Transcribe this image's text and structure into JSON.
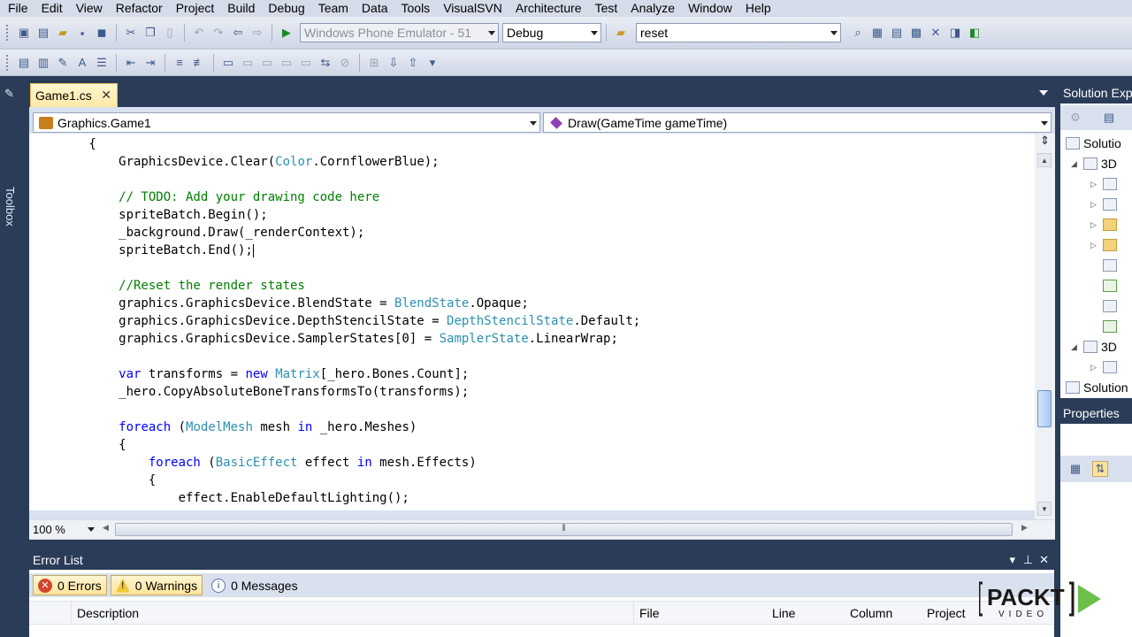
{
  "menu": [
    "File",
    "Edit",
    "View",
    "Refactor",
    "Project",
    "Build",
    "Debug",
    "Team",
    "Data",
    "Tools",
    "VisualSVN",
    "Architecture",
    "Test",
    "Analyze",
    "Window",
    "Help"
  ],
  "toolbar": {
    "target_device": "Windows Phone Emulator - 51",
    "configuration": "Debug",
    "find_value": "reset"
  },
  "toolbox_label": "Toolbox",
  "editor": {
    "tab_title": "Game1.cs",
    "class_combo": "Graphics.Game1",
    "member_combo": "Draw(GameTime gameTime)",
    "zoom": "100 %",
    "lines": [
      [
        {
          "t": "        {",
          "c": ""
        }
      ],
      [
        {
          "t": "            GraphicsDevice.Clear(",
          "c": ""
        },
        {
          "t": "Color",
          "c": "ty"
        },
        {
          "t": ".CornflowerBlue);",
          "c": ""
        }
      ],
      [],
      [
        {
          "t": "            // TODO: Add your drawing code here",
          "c": "cm"
        }
      ],
      [
        {
          "t": "            spriteBatch.Begin();",
          "c": ""
        }
      ],
      [
        {
          "t": "            _background.Draw(_renderContext);",
          "c": ""
        }
      ],
      [
        {
          "t": "            spriteBatch.End();",
          "c": ""
        }
      ],
      [],
      [
        {
          "t": "            //Reset the render states",
          "c": "cm"
        }
      ],
      [
        {
          "t": "            graphics.GraphicsDevice.BlendState = ",
          "c": ""
        },
        {
          "t": "BlendState",
          "c": "ty"
        },
        {
          "t": ".Opaque;",
          "c": ""
        }
      ],
      [
        {
          "t": "            graphics.GraphicsDevice.DepthStencilState = ",
          "c": ""
        },
        {
          "t": "DepthStencilState",
          "c": "ty"
        },
        {
          "t": ".Default;",
          "c": ""
        }
      ],
      [
        {
          "t": "            graphics.GraphicsDevice.SamplerStates[0] = ",
          "c": ""
        },
        {
          "t": "SamplerState",
          "c": "ty"
        },
        {
          "t": ".LinearWrap;",
          "c": ""
        }
      ],
      [],
      [
        {
          "t": "            ",
          "c": ""
        },
        {
          "t": "var",
          "c": "kw"
        },
        {
          "t": " transforms = ",
          "c": ""
        },
        {
          "t": "new",
          "c": "kw"
        },
        {
          "t": " ",
          "c": ""
        },
        {
          "t": "Matrix",
          "c": "ty"
        },
        {
          "t": "[_hero.Bones.Count];",
          "c": ""
        }
      ],
      [
        {
          "t": "            _hero.CopyAbsoluteBoneTransformsTo(transforms);",
          "c": ""
        }
      ],
      [],
      [
        {
          "t": "            ",
          "c": ""
        },
        {
          "t": "foreach",
          "c": "kw"
        },
        {
          "t": " (",
          "c": ""
        },
        {
          "t": "ModelMesh",
          "c": "ty"
        },
        {
          "t": " mesh ",
          "c": ""
        },
        {
          "t": "in",
          "c": "kw"
        },
        {
          "t": " _hero.Meshes)",
          "c": ""
        }
      ],
      [
        {
          "t": "            {",
          "c": ""
        }
      ],
      [
        {
          "t": "                ",
          "c": ""
        },
        {
          "t": "foreach",
          "c": "kw"
        },
        {
          "t": " (",
          "c": ""
        },
        {
          "t": "BasicEffect",
          "c": "ty"
        },
        {
          "t": " effect ",
          "c": ""
        },
        {
          "t": "in",
          "c": "kw"
        },
        {
          "t": " mesh.Effects)",
          "c": ""
        }
      ],
      [
        {
          "t": "                {",
          "c": ""
        }
      ],
      [
        {
          "t": "                    effect.EnableDefaultLighting();",
          "c": ""
        }
      ]
    ]
  },
  "solution_explorer": {
    "title": "Solution Exp",
    "nodes": [
      {
        "label": "Solutio",
        "indent": 0,
        "tri": ""
      },
      {
        "label": "3D",
        "indent": 1,
        "tri": "◢",
        "icon": "proj"
      },
      {
        "label": "",
        "indent": 2,
        "tri": "▷",
        "icon": "ref"
      },
      {
        "label": "",
        "indent": 2,
        "tri": "▷",
        "icon": "ref"
      },
      {
        "label": "",
        "indent": 2,
        "tri": "▷",
        "icon": "folder"
      },
      {
        "label": "",
        "indent": 2,
        "tri": "▷",
        "icon": "folder"
      },
      {
        "label": "",
        "indent": 2,
        "tri": "",
        "icon": "file"
      },
      {
        "label": "",
        "indent": 2,
        "tri": "",
        "icon": "cs"
      },
      {
        "label": "",
        "indent": 2,
        "tri": "",
        "icon": "file"
      },
      {
        "label": "",
        "indent": 2,
        "tri": "",
        "icon": "cs"
      },
      {
        "label": "3D",
        "indent": 1,
        "tri": "◢",
        "icon": "proj"
      },
      {
        "label": "",
        "indent": 2,
        "tri": "▷",
        "icon": "ref"
      },
      {
        "label": "Solution",
        "indent": 0,
        "tri": "",
        "icon": "file"
      }
    ]
  },
  "properties": {
    "title": "Properties"
  },
  "error_list": {
    "title": "Error List",
    "errors": "0 Errors",
    "warnings": "0 Warnings",
    "messages": "0 Messages",
    "columns": [
      "Description",
      "File",
      "Line",
      "Column",
      "Project"
    ]
  },
  "watermark": {
    "brand": "PACKT",
    "sub": "VIDEO"
  },
  "colors": {
    "keyword": "#0000ff",
    "type": "#2b91af",
    "comment": "#008000",
    "chrome": "#2b3c59",
    "tab_active": "#ffe8a6"
  }
}
